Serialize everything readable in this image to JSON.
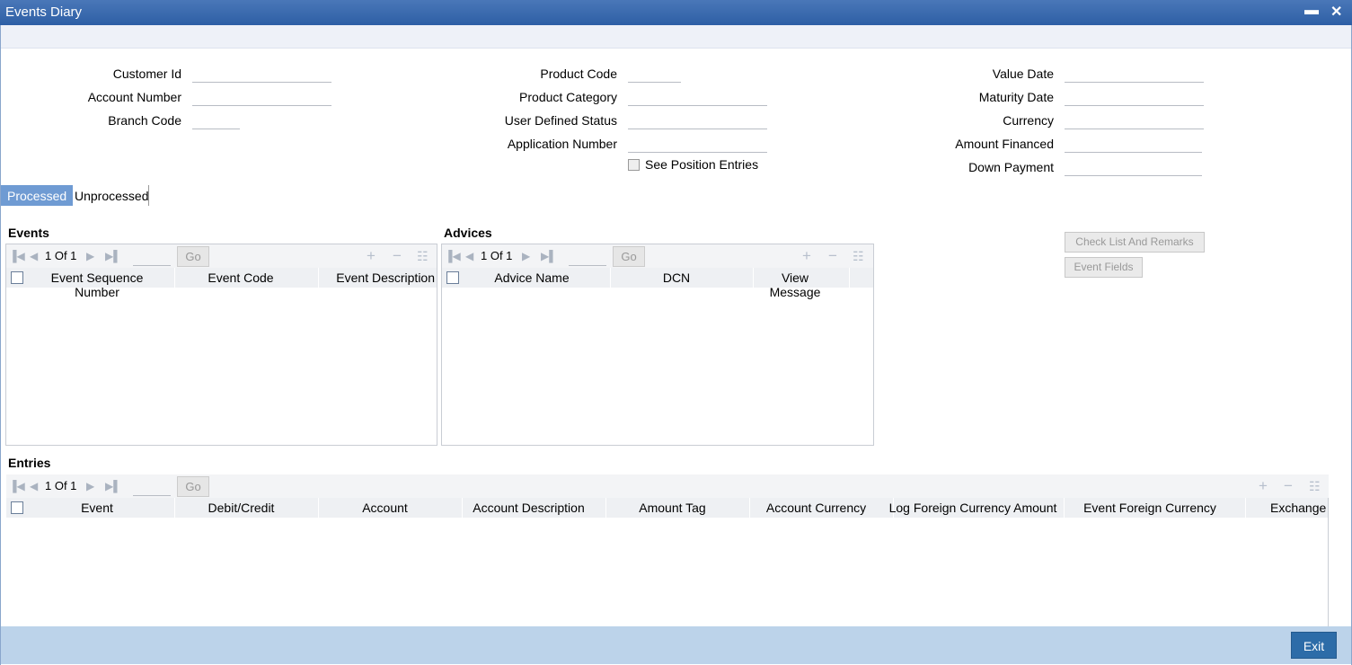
{
  "window": {
    "title": "Events Diary",
    "minimize": "▬",
    "close": "✕"
  },
  "fields": {
    "col1": [
      {
        "label": "Customer Id",
        "value": ""
      },
      {
        "label": "Account Number",
        "value": ""
      },
      {
        "label": "Branch Code",
        "value": ""
      }
    ],
    "col2": [
      {
        "label": "Product Code",
        "value": ""
      },
      {
        "label": "Product Category",
        "value": ""
      },
      {
        "label": "User Defined Status",
        "value": ""
      },
      {
        "label": "Application Number",
        "value": ""
      }
    ],
    "col3": [
      {
        "label": "Value Date",
        "value": ""
      },
      {
        "label": "Maturity Date",
        "value": ""
      },
      {
        "label": "Currency",
        "value": ""
      },
      {
        "label": "Amount Financed",
        "value": ""
      },
      {
        "label": "Down Payment",
        "value": ""
      }
    ],
    "see_position_entries": "See Position Entries"
  },
  "tabs": {
    "processed": "Processed",
    "unprocessed": "Unprocessed"
  },
  "events": {
    "title": "Events",
    "pager": "1 Of 1",
    "go": "Go",
    "columns": [
      "Event Sequence Number",
      "Event Code",
      "Event Description"
    ]
  },
  "advices": {
    "title": "Advices",
    "pager": "1 Of 1",
    "go": "Go",
    "columns": [
      "Advice Name",
      "DCN",
      "View Message"
    ]
  },
  "side_buttons": {
    "checklist": "Check List And Remarks",
    "event_fields": "Event Fields"
  },
  "entries": {
    "title": "Entries",
    "pager": "1 Of 1",
    "go": "Go",
    "columns": [
      "Event",
      "Debit/Credit",
      "Account",
      "Account Description",
      "Amount Tag",
      "Account Currency",
      "Log Foreign Currency Amount",
      "Event Foreign Currency Amount",
      "Exchange I"
    ]
  },
  "footer": {
    "exit": "Exit"
  },
  "icons": {
    "first": "first-page-icon",
    "prev": "prev-page-icon",
    "next": "next-page-icon",
    "last": "last-page-icon",
    "add": "add-row-icon",
    "remove": "remove-row-icon",
    "options": "options-icon"
  }
}
